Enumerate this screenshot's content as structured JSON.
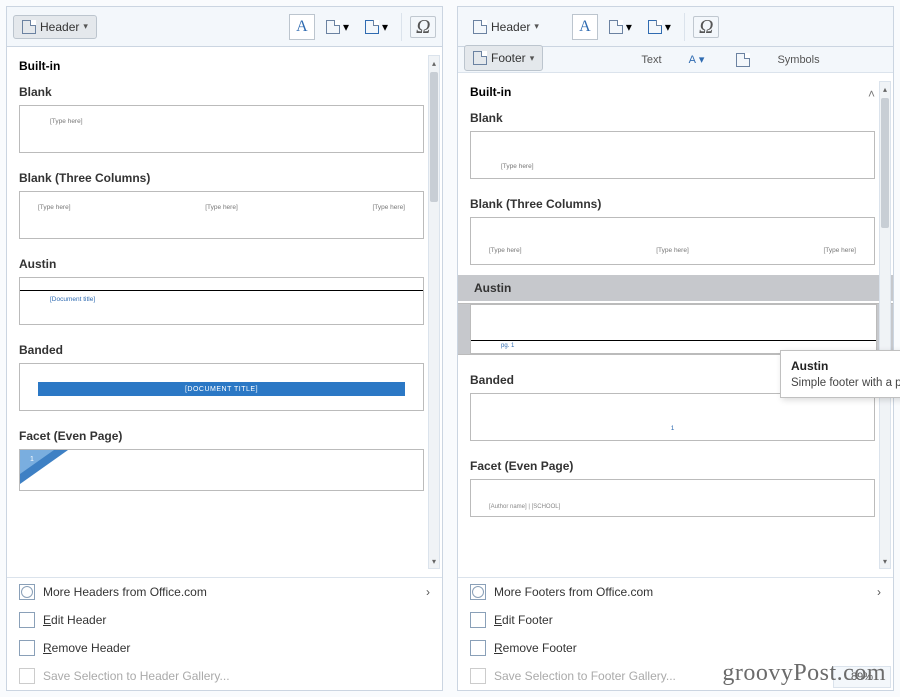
{
  "left": {
    "ribbon": {
      "header_btn": "Header"
    },
    "gallery": {
      "section": "Built-in",
      "presets": {
        "blank": {
          "label": "Blank",
          "placeholder": "[Type here]"
        },
        "three_cols": {
          "label": "Blank (Three Columns)",
          "c1": "[Type here]",
          "c2": "[Type here]",
          "c3": "[Type here]"
        },
        "austin": {
          "label": "Austin",
          "placeholder": "[Document title]"
        },
        "banded": {
          "label": "Banded",
          "placeholder": "[DOCUMENT TITLE]"
        },
        "facet_even": {
          "label": "Facet (Even Page)",
          "num": "1"
        }
      }
    },
    "footer": {
      "more": "More Headers from Office.com",
      "edit": "Edit Header",
      "remove": "Remove Header",
      "save": "Save Selection to Header Gallery..."
    }
  },
  "right": {
    "ribbon": {
      "header_btn": "Header",
      "footer_btn": "Footer",
      "text_group": "Text",
      "symbols_group": "Symbols"
    },
    "gallery": {
      "section": "Built-in",
      "presets": {
        "blank": {
          "label": "Blank",
          "placeholder": "[Type here]"
        },
        "three_cols": {
          "label": "Blank (Three Columns)",
          "c1": "[Type here]",
          "c2": "[Type here]",
          "c3": "[Type here]"
        },
        "austin": {
          "label": "Austin",
          "placeholder": "pg. 1"
        },
        "banded": {
          "label": "Banded",
          "num": "1"
        },
        "facet_even": {
          "label": "Facet (Even Page)",
          "placeholder": "[Author name] | [SCHOOL]"
        }
      }
    },
    "footer": {
      "more": "More Footers from Office.com",
      "edit": "Edit Footer",
      "remove": "Remove Footer",
      "save": "Save Selection to Footer Gallery..."
    },
    "tooltip": {
      "title": "Austin",
      "desc": "Simple footer with a page border"
    },
    "zoom": "89%"
  },
  "watermark": "groovyPost.com"
}
